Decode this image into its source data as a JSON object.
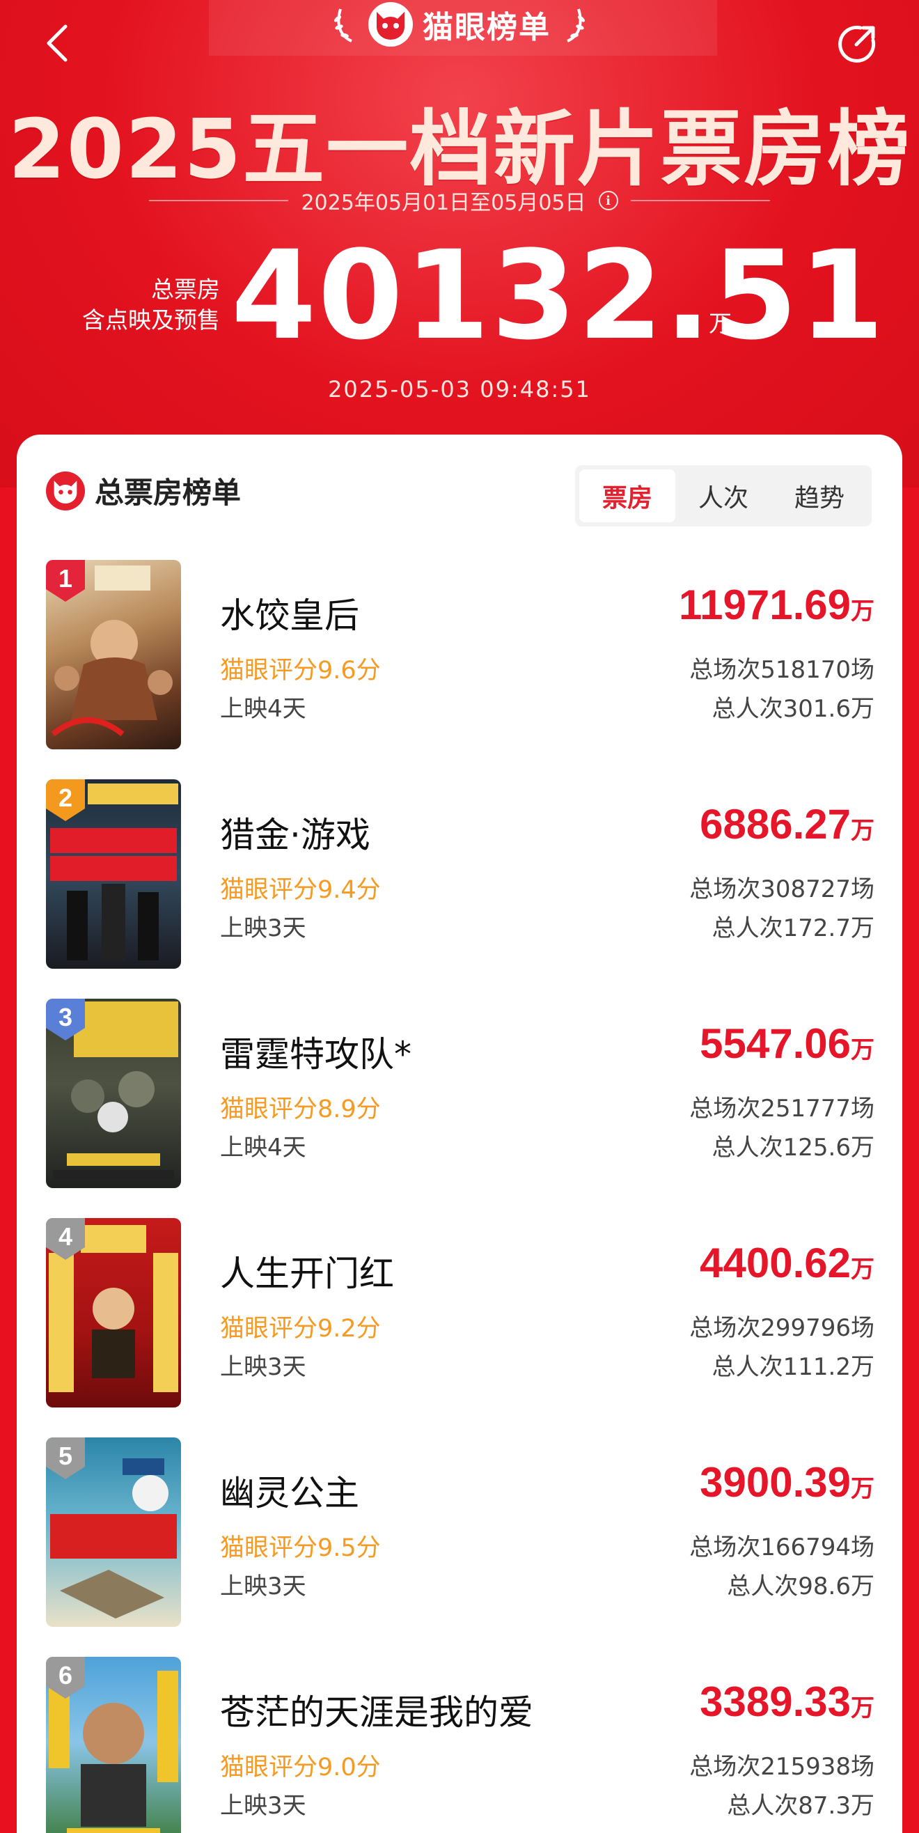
{
  "header": {
    "brand": "猫眼榜单",
    "title": "2025五一档新片票房榜",
    "date_range": "2025年05月01日至05月05日",
    "total_label_line1": "总票房",
    "total_label_line2": "含点映及预售",
    "total_value": "40132.51",
    "total_unit": "万",
    "update_time": "2025-05-03  09:48:51"
  },
  "card": {
    "title": "总票房榜单",
    "tabs": [
      "票房",
      "人次",
      "趋势"
    ],
    "active_tab": "票房"
  },
  "movies": [
    {
      "rank": "1",
      "name": "水饺皇后",
      "score": "猫眼评分9.6分",
      "days": "上映4天",
      "box": "11971.69",
      "unit": "万",
      "shows": "总场次518170场",
      "people": "总人次301.6万",
      "badge_color": "#e3243a"
    },
    {
      "rank": "2",
      "name": "猎金·游戏",
      "score": "猫眼评分9.4分",
      "days": "上映3天",
      "box": "6886.27",
      "unit": "万",
      "shows": "总场次308727场",
      "people": "总人次172.7万",
      "badge_color": "#f39a1e"
    },
    {
      "rank": "3",
      "name": "雷霆特攻队*",
      "score": "猫眼评分8.9分",
      "days": "上映4天",
      "box": "5547.06",
      "unit": "万",
      "shows": "总场次251777场",
      "people": "总人次125.6万",
      "badge_color": "#5a7fd6"
    },
    {
      "rank": "4",
      "name": "人生开门红",
      "score": "猫眼评分9.2分",
      "days": "上映3天",
      "box": "4400.62",
      "unit": "万",
      "shows": "总场次299796场",
      "people": "总人次111.2万",
      "badge_color": "#9a9a9a"
    },
    {
      "rank": "5",
      "name": "幽灵公主",
      "score": "猫眼评分9.5分",
      "days": "上映3天",
      "box": "3900.39",
      "unit": "万",
      "shows": "总场次166794场",
      "people": "总人次98.6万",
      "badge_color": "#9a9a9a"
    },
    {
      "rank": "6",
      "name": "苍茫的天涯是我的爱",
      "score": "猫眼评分9.0分",
      "days": "上映3天",
      "box": "3389.33",
      "unit": "万",
      "shows": "总场次215938场",
      "people": "总人次87.3万",
      "badge_color": "#9a9a9a"
    }
  ]
}
